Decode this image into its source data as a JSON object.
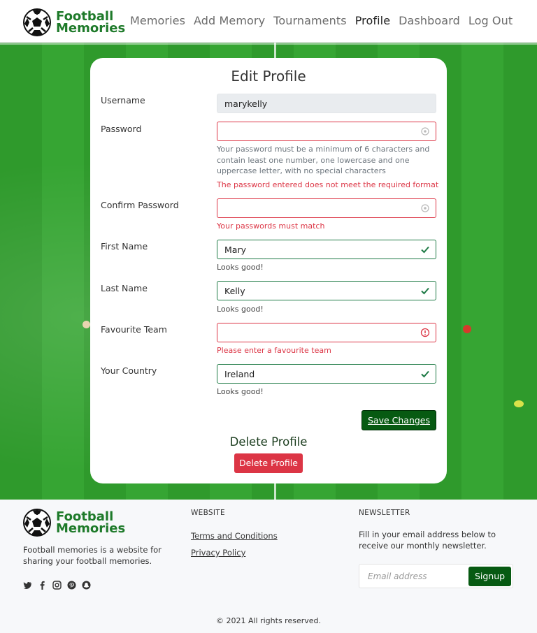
{
  "brand": {
    "line1": "Football",
    "line2": "Memories"
  },
  "nav": [
    {
      "label": "Memories"
    },
    {
      "label": "Add Memory"
    },
    {
      "label": "Tournaments"
    },
    {
      "label": "Profile",
      "active": true
    },
    {
      "label": "Dashboard"
    },
    {
      "label": "Log Out"
    }
  ],
  "form": {
    "title": "Edit Profile",
    "username": {
      "label": "Username",
      "value": "marykelly"
    },
    "password": {
      "label": "Password",
      "value": "",
      "help": "Your password must be a minimum of 6 characters and contain least one number, one lowercase and one uppercase letter, with no special characters",
      "error": "The password entered does not meet the required format"
    },
    "confirm": {
      "label": "Confirm Password",
      "value": "",
      "error": "Your passwords must match"
    },
    "first": {
      "label": "First Name",
      "value": "Mary",
      "ok": "Looks good!"
    },
    "last": {
      "label": "Last Name",
      "value": "Kelly",
      "ok": "Looks good!"
    },
    "team": {
      "label": "Favourite Team",
      "value": "",
      "error": "Please enter a favourite team"
    },
    "country": {
      "label": "Your Country",
      "value": "Ireland",
      "ok": "Looks good!"
    },
    "save_label": "Save Changes",
    "delete_heading": "Delete Profile",
    "delete_label": "Delete Profile"
  },
  "footer": {
    "desc": "Football memories is a website for sharing your football memories.",
    "website_heading": "WEBSITE",
    "links": [
      "Terms and Conditions",
      "Privacy Policy"
    ],
    "newsletter_heading": "NEWSLETTER",
    "newsletter_text": "Fill in your email address below to receive our monthly newsletter.",
    "email_placeholder": "Email address",
    "signup_label": "Signup",
    "copyright": "© 2021 All rights reserved."
  },
  "icons": [
    "twitter-icon",
    "facebook-icon",
    "instagram-icon",
    "pinterest-icon",
    "snapchat-icon"
  ],
  "colors": {
    "brand_green": "#075a12",
    "danger": "#dc3545",
    "success": "#1e7a45"
  }
}
